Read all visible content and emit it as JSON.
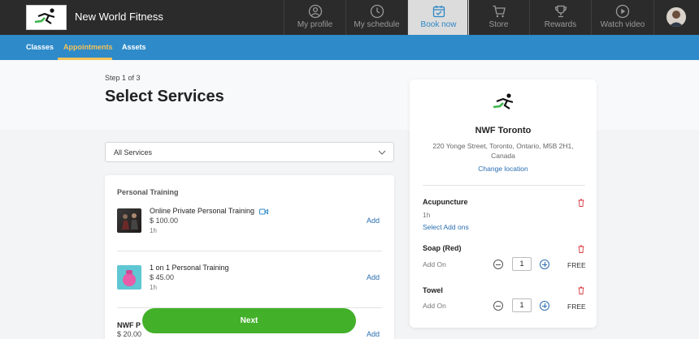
{
  "app": {
    "brand": "New World Fitness",
    "logo_text": "New World Fitness"
  },
  "nav": [
    {
      "label": "My profile",
      "icon": "user-circle-icon"
    },
    {
      "label": "My schedule",
      "icon": "clock-icon"
    },
    {
      "label": "Book now",
      "icon": "calendar-check-icon",
      "active": true
    },
    {
      "label": "Store",
      "icon": "cart-icon"
    },
    {
      "label": "Rewards",
      "icon": "trophy-icon"
    },
    {
      "label": "Watch video",
      "icon": "play-circle-icon"
    }
  ],
  "subnav": {
    "classes": "Classes",
    "appointments": "Appointments",
    "assets": "Assets"
  },
  "page": {
    "step": "Step 1 of 3",
    "title": "Select Services"
  },
  "filter": {
    "selected": "All Services"
  },
  "services": {
    "section": "Personal Training",
    "items": [
      {
        "name": "Online Private Personal Training",
        "price": "$ 100.00",
        "duration": "1h",
        "add": "Add"
      },
      {
        "name": "1 on 1 Personal Training",
        "price": "$ 45.00",
        "duration": "1h",
        "add": "Add"
      },
      {
        "name": "NWF P",
        "price": "$ 20.00",
        "duration": "",
        "add": "Add"
      }
    ],
    "next": "Next"
  },
  "location": {
    "name": "NWF Toronto",
    "address_line1": "220 Yonge Street, Toronto, Ontario, M5B 2H1,",
    "address_line2": "Canada",
    "change": "Change location"
  },
  "cart": {
    "service": {
      "name": "Acupuncture",
      "duration": "1h",
      "link": "Select Add ons"
    },
    "addons": [
      {
        "name": "Soap (Red)",
        "label": "Add On",
        "qty": "1",
        "price": "FREE"
      },
      {
        "name": "Towel",
        "label": "Add On",
        "qty": "1",
        "price": "FREE"
      }
    ]
  },
  "colors": {
    "topbar": "#2b2b2b",
    "subnav": "#2e8ac9",
    "accent": "#f3c35b",
    "link": "#2a6db0",
    "next": "#43b02a",
    "trash": "#d9363e"
  }
}
